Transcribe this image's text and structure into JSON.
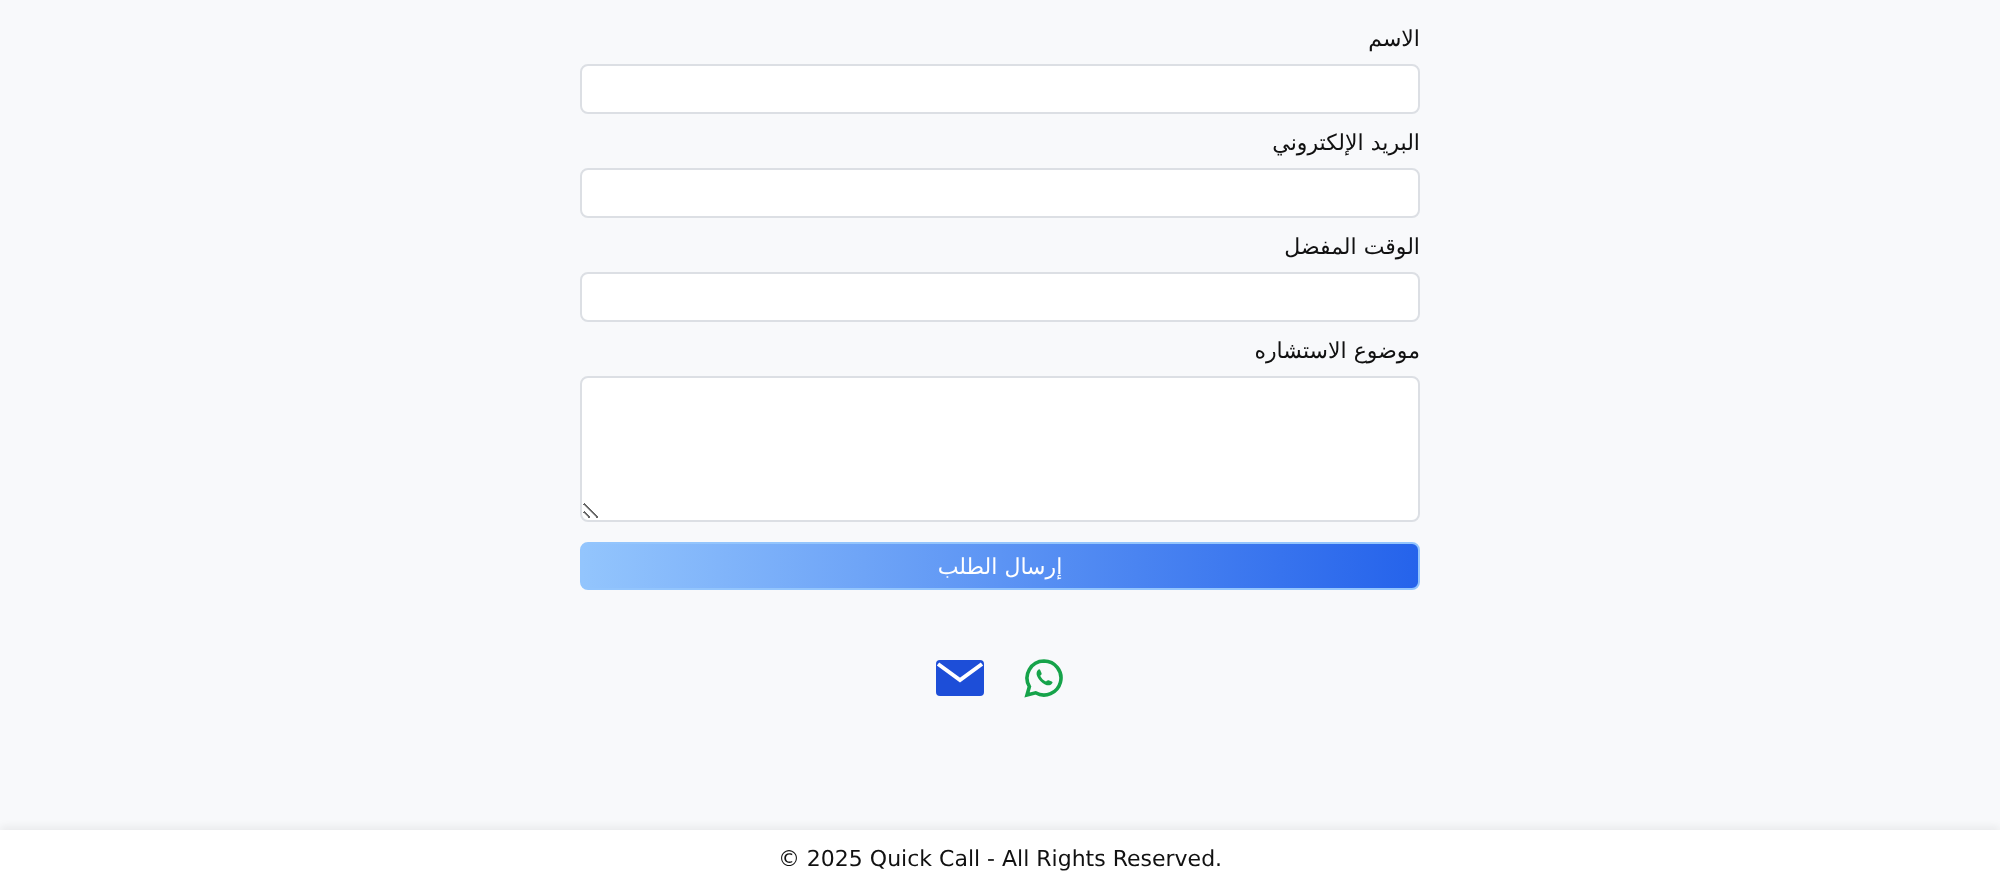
{
  "form": {
    "fields": [
      {
        "kind": "input",
        "label": "الاسم"
      },
      {
        "kind": "input",
        "label": "البريد الإلكتروني"
      },
      {
        "kind": "input",
        "label": "الوقت المفضل"
      },
      {
        "kind": "textarea",
        "label": "موضوع الاستشاره"
      }
    ],
    "submit": "إرسال الطلب"
  },
  "contact_links": [
    {
      "kind": "email"
    },
    {
      "kind": "whatsapp"
    }
  ],
  "footer": {
    "text": "© 2025 Quick Call - All Rights Reserved."
  }
}
